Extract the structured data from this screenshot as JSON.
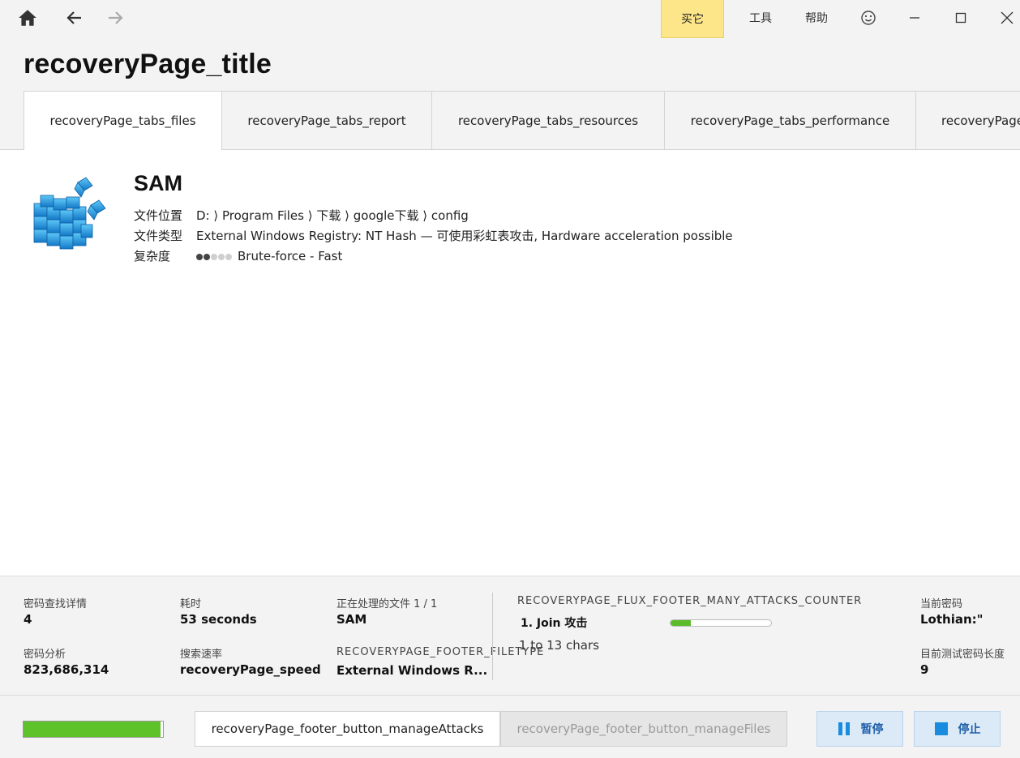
{
  "header": {
    "buy_label": "买它",
    "menu": {
      "tools": "工具",
      "help": "帮助"
    },
    "title": "recoveryPage_title"
  },
  "tabs": [
    {
      "label": "recoveryPage_tabs_files",
      "active": true
    },
    {
      "label": "recoveryPage_tabs_report"
    },
    {
      "label": "recoveryPage_tabs_resources"
    },
    {
      "label": "recoveryPage_tabs_performance"
    },
    {
      "label": "recoveryPage_tabs_..."
    }
  ],
  "file": {
    "icon": "registry-cubes-icon",
    "name": "SAM",
    "location_label": "文件位置",
    "location_value": "D: ⟩ Program Files ⟩ 下载 ⟩ google下载 ⟩ config",
    "type_label": "文件类型",
    "type_value": "External Windows Registry: NT Hash — 可使用彩虹表攻击, Hardware acceleration possible",
    "complexity_label": "复杂度",
    "complexity_level": 2,
    "complexity_max": 5,
    "complexity_value": "Brute-force - Fast"
  },
  "stats": {
    "details_label": "密码查找详情",
    "details_value": "4",
    "analysis_label": "密码分析",
    "analysis_value": "823,686,314",
    "elapsed_label": "耗时",
    "elapsed_value": "53 seconds",
    "speed_label": "搜索速率",
    "speed_value": "recoveryPage_speed",
    "processing_label": "正在处理的文件  1 / 1",
    "processing_value": "SAM",
    "filetype_label": "RECOVERYPAGE_FOOTER_FILETYPE",
    "filetype_value": "External Windows R...",
    "attacks_counter_label": "RECOVERYPAGE_FLUX_FOOTER_MANY_ATTACKS_COUNTER",
    "attack_name": "1. Join 攻击",
    "attack_progress": 0.2,
    "attack_range": "1 to 13 chars",
    "current_pw_label": "当前密码",
    "current_pw_value": "Lothian:\"",
    "current_len_label": "目前测试密码长度",
    "current_len_value": "9"
  },
  "footer": {
    "overall_progress": 0.98,
    "manage_attacks": "recoveryPage_footer_button_manageAttacks",
    "manage_files": "recoveryPage_footer_button_manageFiles",
    "pause": "暂停",
    "stop": "停止"
  },
  "colors": {
    "accent_blue": "#1a8ce0",
    "progress_green": "#5ec22a",
    "buy_yellow": "#fde68a"
  }
}
